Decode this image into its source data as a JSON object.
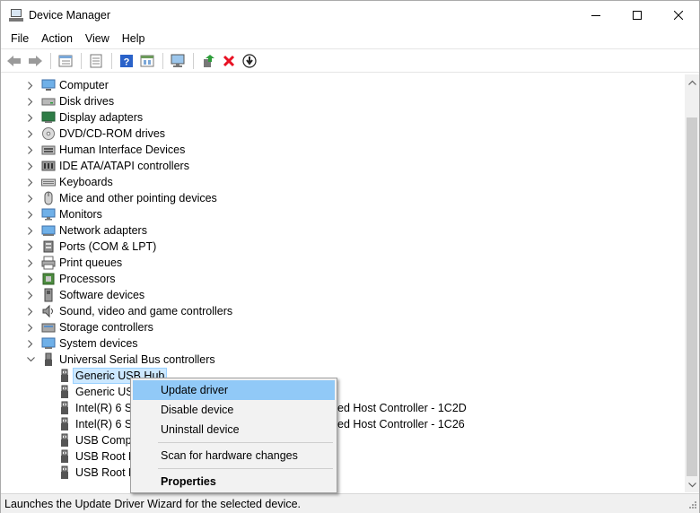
{
  "window": {
    "title": "Device Manager"
  },
  "menubar": {
    "items": [
      "File",
      "Action",
      "View",
      "Help"
    ]
  },
  "toolbar": {
    "buttons": [
      "back-icon",
      "forward-icon",
      "device-list-icon",
      "properties-icon",
      "help-icon",
      "resource-view-icon",
      "scan-hardware-icon",
      "update-driver-icon",
      "uninstall-icon",
      "download-driver-icon"
    ]
  },
  "tree": {
    "categories": [
      {
        "label": "Computer",
        "icon": "computer-icon"
      },
      {
        "label": "Disk drives",
        "icon": "disk-drive-icon"
      },
      {
        "label": "Display adapters",
        "icon": "display-adapter-icon"
      },
      {
        "label": "DVD/CD-ROM drives",
        "icon": "dvd-drive-icon"
      },
      {
        "label": "Human Interface Devices",
        "icon": "hid-icon"
      },
      {
        "label": "IDE ATA/ATAPI controllers",
        "icon": "ide-controller-icon"
      },
      {
        "label": "Keyboards",
        "icon": "keyboard-icon"
      },
      {
        "label": "Mice and other pointing devices",
        "icon": "mouse-icon"
      },
      {
        "label": "Monitors",
        "icon": "monitor-icon"
      },
      {
        "label": "Network adapters",
        "icon": "network-adapter-icon"
      },
      {
        "label": "Ports (COM & LPT)",
        "icon": "port-icon"
      },
      {
        "label": "Print queues",
        "icon": "printer-icon"
      },
      {
        "label": "Processors",
        "icon": "processor-icon"
      },
      {
        "label": "Software devices",
        "icon": "software-device-icon"
      },
      {
        "label": "Sound, video and game controllers",
        "icon": "speaker-icon"
      },
      {
        "label": "Storage controllers",
        "icon": "storage-controller-icon"
      },
      {
        "label": "System devices",
        "icon": "system-device-icon"
      },
      {
        "label": "Universal Serial Bus controllers",
        "icon": "usb-icon"
      }
    ],
    "usb_children": [
      {
        "label": "Generic USB Hub",
        "suffix": ""
      },
      {
        "label": "Generic USB Hub",
        "suffix": ""
      },
      {
        "label": "Intel(R) 6 Series/C200 Series Chipset Family USB Enhanced Host Controller - 1C2D",
        "suffix": "ed Host Controller - 1C2D"
      },
      {
        "label": "Intel(R) 6 Series/C200 Series Chipset Family USB Enhanced Host Controller - 1C26",
        "suffix": "ed Host Controller - 1C26"
      },
      {
        "label": "USB Composite Device",
        "suffix": ""
      },
      {
        "label": "USB Root Hub",
        "suffix": ""
      },
      {
        "label": "USB Root Hub",
        "suffix": ""
      }
    ],
    "usb_children_visible": [
      "Generic USB Hub",
      "Generic US",
      "Intel(R) 6 Se",
      "Intel(R) 6 Se",
      "USB Comp",
      "USB Root H",
      "USB Root H"
    ]
  },
  "context_menu": {
    "update_driver": "Update driver",
    "disable_device": "Disable device",
    "uninstall_device": "Uninstall device",
    "scan_hardware": "Scan for hardware changes",
    "properties": "Properties"
  },
  "statusbar": {
    "text": "Launches the Update Driver Wizard for the selected device."
  },
  "colors": {
    "selection": "#cce8ff",
    "menu_highlight": "#91c9f7",
    "uninstall_red": "#e81123"
  }
}
